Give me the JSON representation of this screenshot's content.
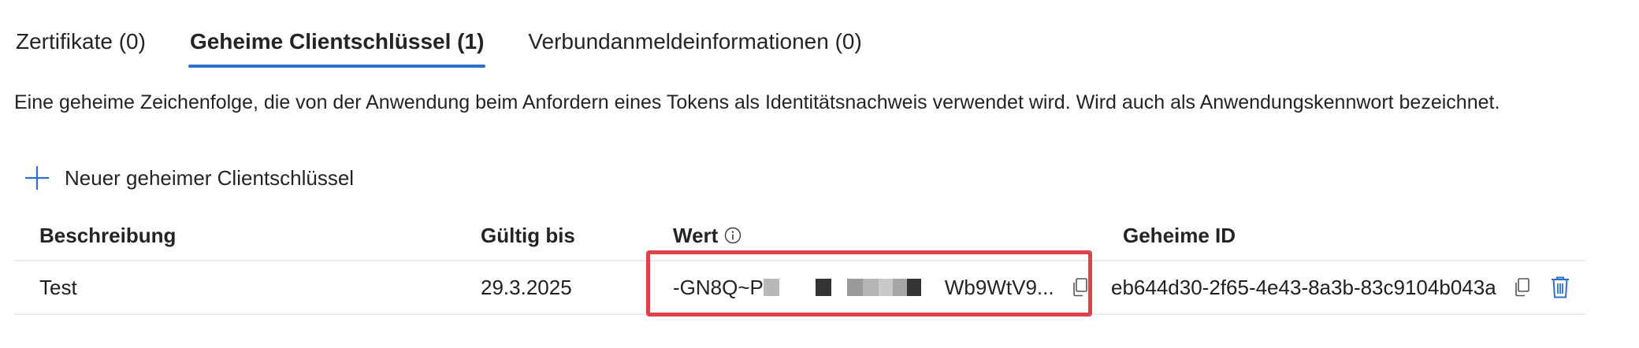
{
  "tabs": [
    {
      "label": "Zertifikate (0)",
      "active": false
    },
    {
      "label": "Geheime Clientschlüssel (1)",
      "active": true
    },
    {
      "label": "Verbundanmeldeinformationen (0)",
      "active": false
    }
  ],
  "description": "Eine geheime Zeichenfolge, die von der Anwendung beim Anfordern eines Tokens als Identitätsnachweis verwendet wird. Wird auch als Anwendungskennwort bezeichnet.",
  "add_button": {
    "label": "Neuer geheimer Clientschlüssel",
    "icon": "plus-icon"
  },
  "table": {
    "headers": {
      "description": "Beschreibung",
      "expires": "Gültig bis",
      "value": "Wert",
      "secret_id": "Geheime ID"
    },
    "rows": [
      {
        "description": "Test",
        "expires": "29.3.2025",
        "value_prefix": "-GN8Q~P",
        "value_suffix": "Wb9WtV9...",
        "secret_id": "eb644d30-2f65-4e43-8a3b-83c9104b043a"
      }
    ]
  },
  "colors": {
    "accent": "#2f6fc6",
    "highlight_border": "#e0404a",
    "text": "#242424",
    "divider": "#ececec"
  },
  "icons": {
    "info": "info-icon",
    "copy": "copy-icon",
    "delete": "trash-icon"
  }
}
